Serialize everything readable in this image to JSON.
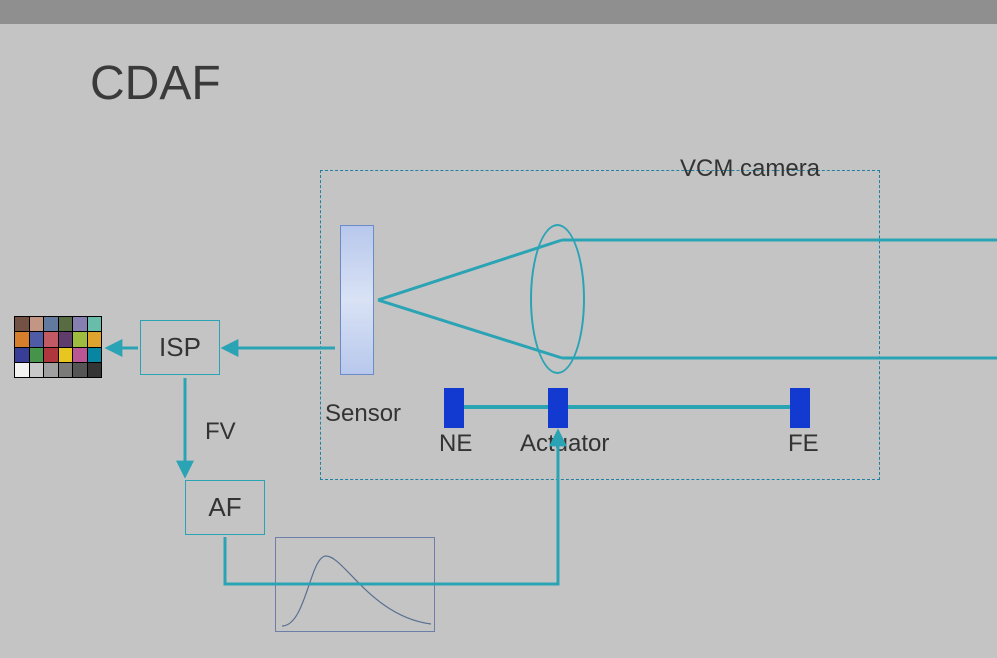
{
  "title": "CDAF",
  "vcm_label": "VCM camera",
  "sensor_label": "Sensor",
  "ne_label": "NE",
  "actuator_label": "Actuator",
  "fe_label": "FE",
  "isp_label": "ISP",
  "af_label": "AF",
  "fv_label": "FV",
  "blocks": {
    "isp": "ISP",
    "af": "AF",
    "sensor": "Sensor",
    "lens": "Lens",
    "actuator_rail": [
      "NE",
      "Actuator",
      "FE"
    ]
  },
  "flow": [
    "Light → Lens → Sensor",
    "Sensor → ISP (image + FV)",
    "ISP → FV → AF",
    "AF → curve → Actuator",
    "Actuator moves Lens"
  ],
  "color_checker_colors": [
    "#735244",
    "#c29682",
    "#627a9d",
    "#576c43",
    "#8580b1",
    "#67bdaa",
    "#d67e2c",
    "#505ba6",
    "#c15a63",
    "#5e3c6c",
    "#9dbc40",
    "#e0a32e",
    "#383d96",
    "#469449",
    "#af363c",
    "#e7c71f",
    "#bb5695",
    "#0885a1",
    "#f3f3f2",
    "#c8c8c8",
    "#a0a0a0",
    "#7a7a79",
    "#555555",
    "#343434"
  ]
}
